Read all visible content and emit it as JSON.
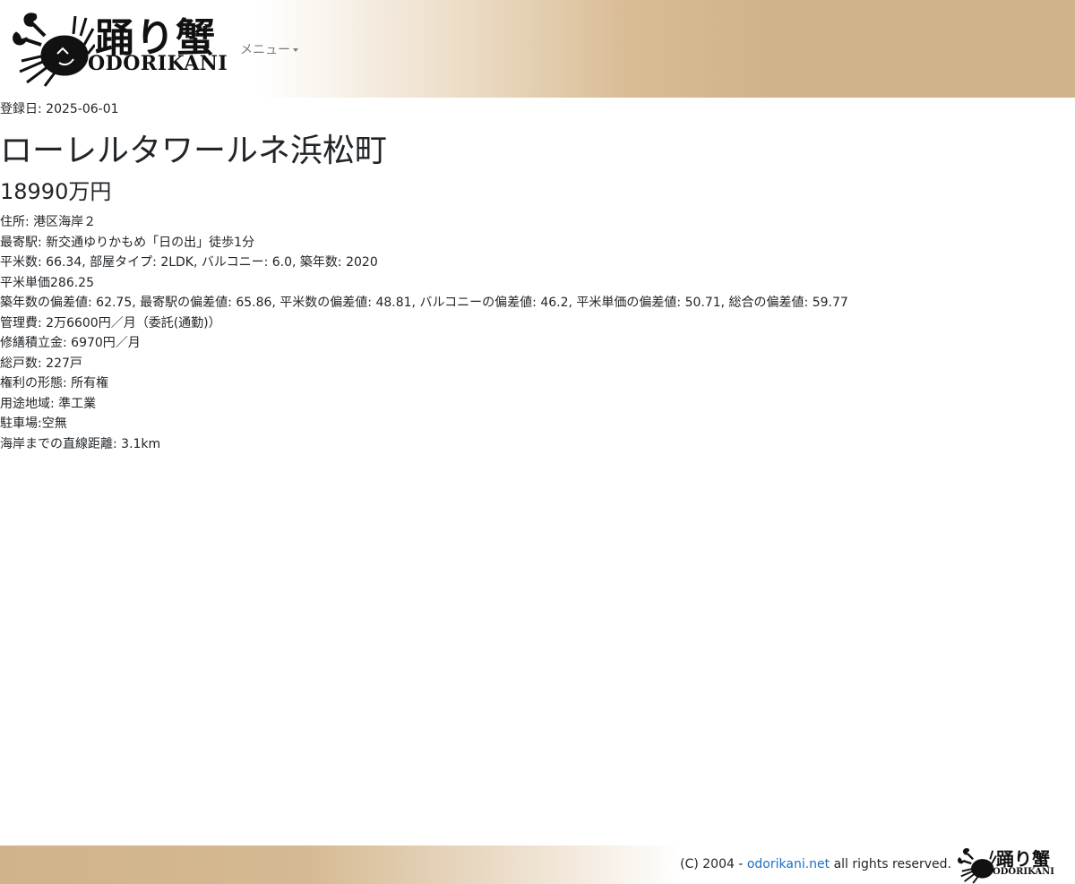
{
  "header": {
    "logo_kanji": "踊り蟹",
    "logo_roman": "ODORIKANI",
    "menu_label": "メニュー"
  },
  "property": {
    "registered": "登録日: 2025-06-01",
    "name": "ローレルタワールネ浜松町",
    "price": "18990万円",
    "details": [
      "住所: 港区海岸２",
      "最寄駅: 新交通ゆりかもめ「日の出」徒歩1分",
      "平米数: 66.34, 部屋タイプ: 2LDK, バルコニー: 6.0, 築年数: 2020",
      "平米単価286.25",
      "築年数の偏差値: 62.75, 最寄駅の偏差値: 65.86, 平米数の偏差値: 48.81, バルコニーの偏差値: 46.2, 平米単価の偏差値: 50.71, 総合の偏差値: 59.77",
      "管理費: 2万6600円／月（委託(通勤)）",
      "修繕積立金: 6970円／月",
      "総戸数: 227戸",
      "権利の形態: 所有権",
      "用途地域: 準工業",
      "駐車場:空無",
      "海岸までの直線距離: 3.1km"
    ]
  },
  "footer": {
    "copyright_prefix": "(C) 2004 - ",
    "site_link": "odorikani.net",
    "copyright_suffix": " all rights reserved.",
    "logo_kanji": "踊り蟹",
    "logo_roman": "ODORIKANI"
  },
  "colors": {
    "accent_tan": "#d0b38a",
    "link": "#1a6fc4",
    "menu_text": "#7a7a7a"
  }
}
